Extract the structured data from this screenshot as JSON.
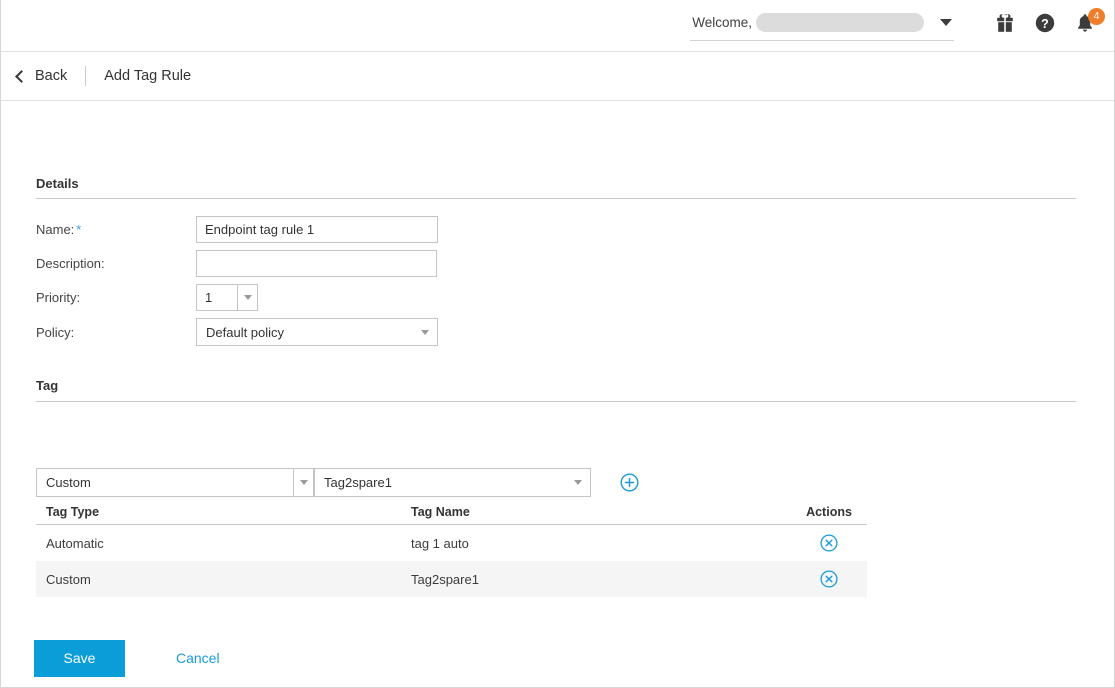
{
  "header": {
    "welcome_label": "Welcome,",
    "username_masked": "",
    "icons": {
      "gift": "gift-icon",
      "help": "help-icon",
      "notifications": "bell-icon"
    },
    "notification_count": "4",
    "badge_color": "#f07d28"
  },
  "breadcrumb": {
    "back_label": "Back",
    "page_title": "Add Tag Rule"
  },
  "details": {
    "section_title": "Details",
    "fields": {
      "name_label": "Name:",
      "name_required": "*",
      "name_value": "Endpoint tag rule 1",
      "description_label": "Description:",
      "description_value": "",
      "priority_label": "Priority:",
      "priority_value": "1",
      "policy_label": "Policy:",
      "policy_value": "Default policy"
    }
  },
  "tag": {
    "section_title": "Tag",
    "tag_type_selected": "Custom",
    "tag_name_selected": "Tag2spare1",
    "add_button": "add-tag-button",
    "table": {
      "columns": [
        "Tag Type",
        "Tag Name",
        "Actions"
      ],
      "rows": [
        {
          "type": "Automatic",
          "name": "tag 1 auto",
          "action": "remove"
        },
        {
          "type": "Custom",
          "name": "Tag2spare1",
          "action": "remove"
        }
      ]
    }
  },
  "footer": {
    "save_label": "Save",
    "cancel_label": "Cancel"
  },
  "colors": {
    "accent": "#0b9dd8",
    "link": "#1a9bd7",
    "required": "#3ba3dd",
    "badge": "#f07d28"
  }
}
